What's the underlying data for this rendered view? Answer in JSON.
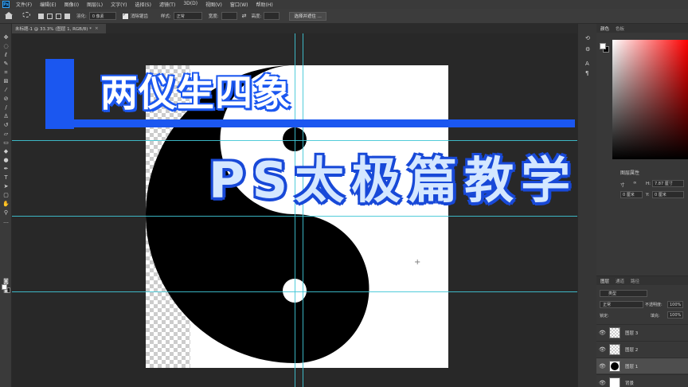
{
  "menubar": {
    "logo": "Ps",
    "items": [
      "文件(F)",
      "编辑(E)",
      "图像(I)",
      "图层(L)",
      "文字(Y)",
      "选择(S)",
      "滤镜(T)",
      "3D(D)",
      "视图(V)",
      "窗口(W)",
      "帮助(H)"
    ]
  },
  "options": {
    "feather_label": "羽化:",
    "feather_value": "0 像素",
    "antialias_label": "消除锯齿",
    "style_label": "样式:",
    "style_value": "正常",
    "width_label": "宽度:",
    "select_mask_button": "选择并遮住 ..."
  },
  "document": {
    "tab_title": "未标题-1 @ 33.3% (图层 1, RGB/8) *",
    "close": "×"
  },
  "overlay": {
    "title_line1": "两仪生四象",
    "title_line2": "PS太极篇教学"
  },
  "right_panel": {
    "color_tabs": [
      "颜色",
      "色板"
    ],
    "properties_label": "图层属性",
    "w_label": "寸",
    "h_label": "H:",
    "h_value": "7.87 厘寸",
    "x_value": "0 厘米",
    "y_label": "Y:",
    "y_value": "0 厘米"
  },
  "layers_panel": {
    "tabs": [
      "图层",
      "通道",
      "路径"
    ],
    "filter_label": "类型",
    "blend_mode": "正常",
    "opacity_label": "不透明度:",
    "opacity_value": "100%",
    "lock_label": "锁定:",
    "fill_label": "填充:",
    "fill_value": "100%",
    "layers": [
      {
        "name": "图层 3",
        "thumb": "transparent",
        "selected": false
      },
      {
        "name": "图层 2",
        "thumb": "transparent",
        "selected": false
      },
      {
        "name": "图层 1",
        "thumb": "black-circle",
        "selected": true
      },
      {
        "name": "背景",
        "thumb": "white",
        "selected": false
      }
    ]
  },
  "colors": {
    "accent_blue": "#1b57f0",
    "guide_cyan": "#3fc7d6"
  }
}
